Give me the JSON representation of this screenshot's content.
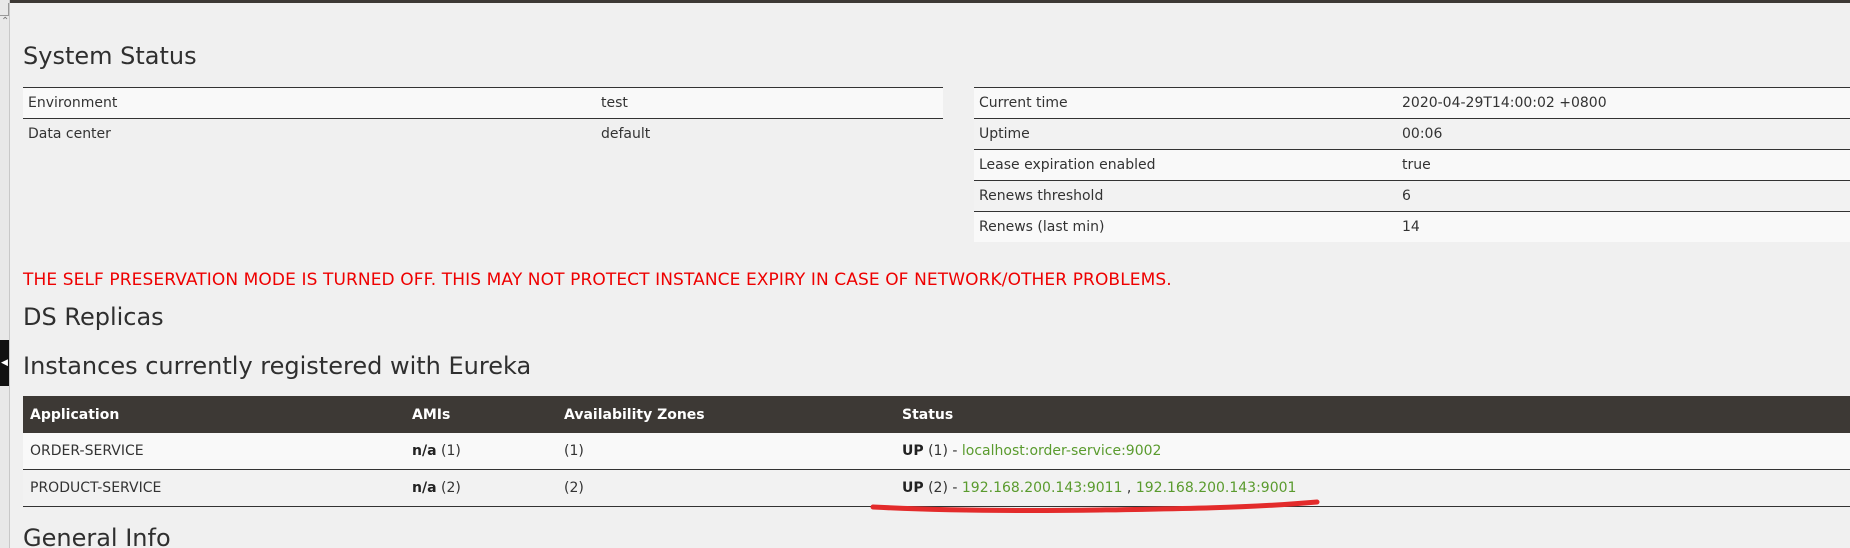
{
  "page": {
    "system_status_title": "System Status",
    "ds_replicas_title": "DS Replicas",
    "instances_title": "Instances currently registered with Eureka",
    "general_info_title": "General Info",
    "warning": "THE SELF PRESERVATION MODE IS TURNED OFF. THIS MAY NOT PROTECT INSTANCE EXPIRY IN CASE OF NETWORK/OTHER PROBLEMS."
  },
  "system_status": {
    "left": [
      {
        "label": "Environment",
        "value": "test"
      },
      {
        "label": "Data center",
        "value": "default"
      }
    ],
    "right": [
      {
        "label": "Current time",
        "value": "2020-04-29T14:00:02 +0800"
      },
      {
        "label": "Uptime",
        "value": "00:06"
      },
      {
        "label": "Lease expiration enabled",
        "value": "true"
      },
      {
        "label": "Renews threshold",
        "value": "6"
      },
      {
        "label": "Renews (last min)",
        "value": "14"
      }
    ]
  },
  "instances": {
    "headers": [
      "Application",
      "AMIs",
      "Availability Zones",
      "Status"
    ],
    "rows": [
      {
        "application": "ORDER-SERVICE",
        "amis_prefix": "n/a",
        "amis_count": "(1)",
        "zones": "(1)",
        "status_state": "UP",
        "status_count": "(1)",
        "status_sep": " - ",
        "link1": "localhost:order-service:9002",
        "link_sep": "",
        "link2": ""
      },
      {
        "application": "PRODUCT-SERVICE",
        "amis_prefix": "n/a",
        "amis_count": "(2)",
        "zones": "(2)",
        "status_state": "UP",
        "status_count": "(2)",
        "status_sep": " - ",
        "link1": "192.168.200.143:9011",
        "link_sep": " , ",
        "link2": "192.168.200.143:9001"
      }
    ]
  },
  "colors": {
    "warning": "#ee0000",
    "header_bg": "#3d3935",
    "link": "#5a9b2e",
    "annotation": "#e32b2b"
  },
  "icons": {
    "collapse_tab": "chevron-left-icon"
  }
}
